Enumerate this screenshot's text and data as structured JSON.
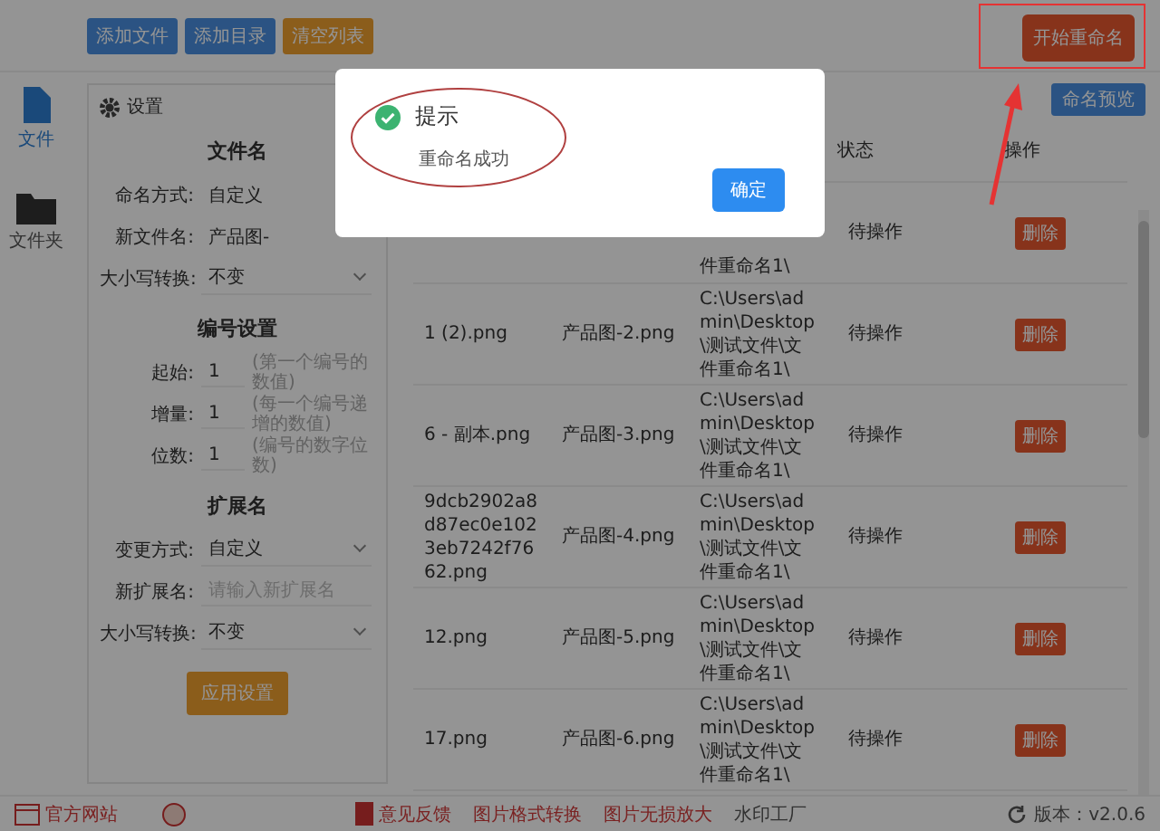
{
  "toolbar": {
    "buttons": [
      {
        "label": "添加文件",
        "kind": "primary"
      },
      {
        "label": "添加目录",
        "kind": "primary"
      },
      {
        "label": "清空列表",
        "kind": "warning"
      }
    ],
    "start_button": "开始重命名"
  },
  "sidebar": {
    "items": [
      {
        "label": "文件",
        "kind": "file",
        "selected": true
      },
      {
        "label": "文件夹",
        "kind": "folder",
        "selected": false
      }
    ]
  },
  "settings": {
    "title": "设置",
    "sections": [
      {
        "title": "文件名",
        "fields": [
          {
            "label": "命名方式:",
            "kind": "plain",
            "value": "自定义"
          },
          {
            "label": "新文件名:",
            "kind": "plain",
            "value": "产品图-"
          },
          {
            "label": "大小写转换:",
            "kind": "select",
            "value": "不变"
          }
        ]
      },
      {
        "title": "编号设置",
        "fields": [
          {
            "label": "起始:",
            "kind": "number",
            "value": "1",
            "hint": "(第一个编号的数值)"
          },
          {
            "label": "增量:",
            "kind": "number",
            "value": "1",
            "hint": "(每一个编号递增的数值)"
          },
          {
            "label": "位数:",
            "kind": "number",
            "value": "1",
            "hint": "(编号的数字位数)"
          }
        ]
      },
      {
        "title": "扩展名",
        "fields": [
          {
            "label": "变更方式:",
            "kind": "select",
            "value": "自定义"
          },
          {
            "label": "新扩展名:",
            "kind": "input",
            "placeholder": "请输入新扩展名"
          },
          {
            "label": "大小写转换:",
            "kind": "select",
            "value": "不变"
          }
        ]
      }
    ],
    "apply_button": "应用设置"
  },
  "table": {
    "preview_button": "命名预览",
    "status_header": "状态",
    "action_header": "操作",
    "rows": [
      {
        "path": "件重命名1\\",
        "status": "待操作",
        "action": "删除"
      },
      {
        "original": "1 (2).png",
        "new": "产品图-2.png",
        "path": "C:\\Users\\admin\\Desktop\\测试文件\\文件重命名1\\",
        "status": "待操作",
        "action": "删除"
      },
      {
        "original": "6 - 副本.png",
        "new": "产品图-3.png",
        "path": "C:\\Users\\admin\\Desktop\\测试文件\\文件重命名1\\",
        "status": "待操作",
        "action": "删除"
      },
      {
        "original": "9dcb2902a8d87ec0e1023eb7242f7662.png",
        "new": "产品图-4.png",
        "path": "C:\\Users\\admin\\Desktop\\测试文件\\文件重命名1\\",
        "status": "待操作",
        "action": "删除"
      },
      {
        "original": "12.png",
        "new": "产品图-5.png",
        "path": "C:\\Users\\admin\\Desktop\\测试文件\\文件重命名1\\",
        "status": "待操作",
        "action": "删除"
      },
      {
        "original": "17.png",
        "new": "产品图-6.png",
        "path": "C:\\Users\\admin\\Desktop\\测试文件\\文件重命名1\\",
        "status": "待操作",
        "action": "删除"
      }
    ]
  },
  "footer": {
    "links": [
      {
        "label": "官方网站",
        "kind": "website"
      },
      {
        "label": "意见反馈",
        "kind": "feedback"
      },
      {
        "label": "图片格式转换",
        "kind": "plain"
      },
      {
        "label": "图片无损放大",
        "kind": "plain"
      },
      {
        "label": "水印工厂",
        "kind": "dark"
      }
    ],
    "version": "版本：v2.0.6"
  },
  "dialog": {
    "title": "提示",
    "message": "重命名成功",
    "ok_button": "确定"
  }
}
